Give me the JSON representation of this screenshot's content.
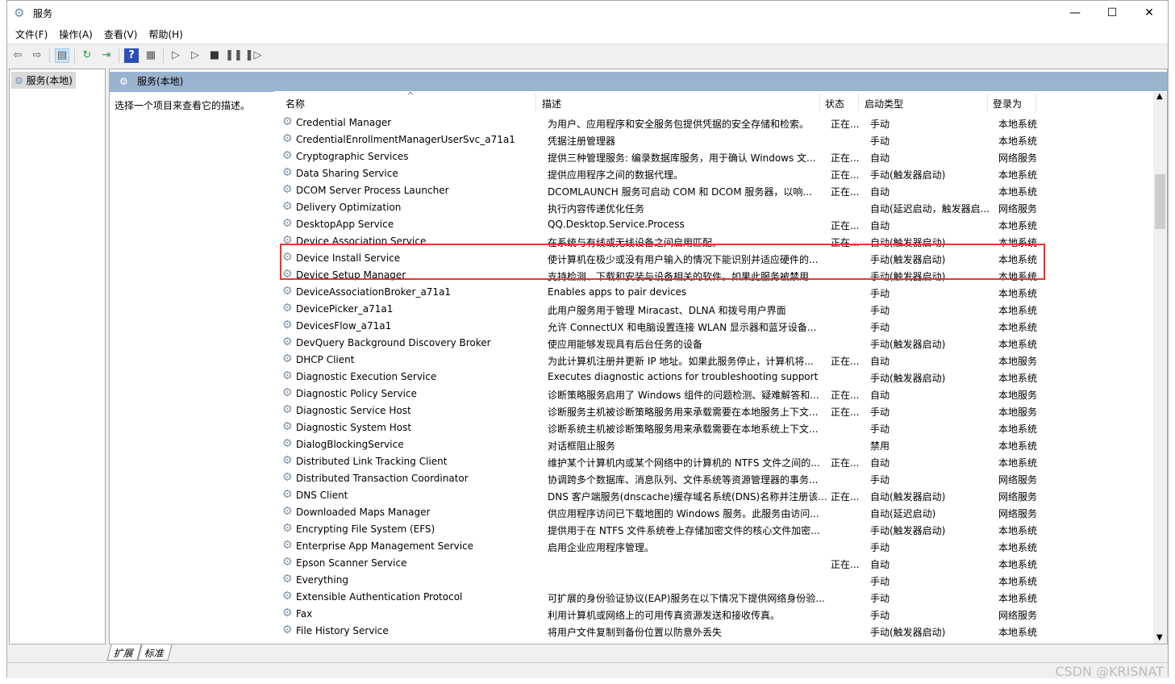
{
  "window": {
    "title": "服务",
    "minimize": "—",
    "maximize": "☐",
    "close": "✕"
  },
  "menu": [
    "文件(F)",
    "操作(A)",
    "查看(V)",
    "帮助(H)"
  ],
  "toolbar": [
    "back-icon",
    "forward-icon",
    "show-hide-tree-icon",
    "refresh-icon",
    "export-icon",
    "help-icon",
    "properties-icon",
    "start-icon",
    "start-alt-icon",
    "stop-icon",
    "pause-icon",
    "resume-icon"
  ],
  "tree": {
    "selected": "服务(本地)"
  },
  "panel": {
    "title": "服务(本地)",
    "description_hint": "选择一个项目来查看它的描述。"
  },
  "columns": {
    "name": "名称",
    "description": "描述",
    "status": "状态",
    "startup": "启动类型",
    "logon": "登录为"
  },
  "rows": [
    [
      "Credential Manager",
      "为用户、应用程序和安全服务包提供凭据的安全存储和检索。",
      "正在...",
      "手动",
      "本地系统"
    ],
    [
      "CredentialEnrollmentManagerUserSvc_a71a1",
      "凭据注册管理器",
      "",
      "手动",
      "本地系统"
    ],
    [
      "Cryptographic Services",
      "提供三种管理服务: 编录数据库服务，用于确认 Windows 文...",
      "正在...",
      "自动",
      "网络服务"
    ],
    [
      "Data Sharing Service",
      "提供应用程序之间的数据代理。",
      "正在...",
      "手动(触发器启动)",
      "本地系统"
    ],
    [
      "DCOM Server Process Launcher",
      "DCOMLAUNCH 服务可启动 COM 和 DCOM 服务器，以响...",
      "正在...",
      "自动",
      "本地系统"
    ],
    [
      "Delivery Optimization",
      "执行内容传递优化任务",
      "",
      "自动(延迟启动，触发器启...",
      "网络服务"
    ],
    [
      "DesktopApp Service",
      "QQ.Desktop.Service.Process",
      "正在...",
      "自动",
      "本地系统"
    ],
    [
      "Device Association Service",
      "在系统与有线或无线设备之间启用匹配。",
      "正在...",
      "自动(触发器启动)",
      "本地系统"
    ],
    [
      "Device Install Service",
      "使计算机在极少或没有用户输入的情况下能识别并适应硬件的...",
      "",
      "手动(触发器启动)",
      "本地系统"
    ],
    [
      "Device Setup Manager",
      "支持检测、下载和安装与设备相关的软件。如果此服务被禁用...",
      "",
      "手动(触发器启动)",
      "本地系统"
    ],
    [
      "DeviceAssociationBroker_a71a1",
      "Enables apps to pair devices",
      "",
      "手动",
      "本地系统"
    ],
    [
      "DevicePicker_a71a1",
      "此用户服务用于管理 Miracast、DLNA 和拨号用户界面",
      "",
      "手动",
      "本地系统"
    ],
    [
      "DevicesFlow_a71a1",
      "允许 ConnectUX 和电脑设置连接 WLAN 显示器和蓝牙设备...",
      "",
      "手动",
      "本地系统"
    ],
    [
      "DevQuery Background Discovery Broker",
      "使应用能够发现具有后台任务的设备",
      "",
      "手动(触发器启动)",
      "本地系统"
    ],
    [
      "DHCP Client",
      "为此计算机注册并更新 IP 地址。如果此服务停止，计算机将...",
      "正在...",
      "自动",
      "本地服务"
    ],
    [
      "Diagnostic Execution Service",
      "Executes diagnostic actions for troubleshooting support",
      "",
      "手动(触发器启动)",
      "本地系统"
    ],
    [
      "Diagnostic Policy Service",
      "诊断策略服务启用了 Windows 组件的问题检测、疑难解答和...",
      "正在...",
      "自动",
      "本地服务"
    ],
    [
      "Diagnostic Service Host",
      "诊断服务主机被诊断策略服务用来承载需要在本地服务上下文...",
      "正在...",
      "手动",
      "本地服务"
    ],
    [
      "Diagnostic System Host",
      "诊断系统主机被诊断策略服务用来承载需要在本地系统上下文...",
      "",
      "手动",
      "本地系统"
    ],
    [
      "DialogBlockingService",
      "对话框阻止服务",
      "",
      "禁用",
      "本地系统"
    ],
    [
      "Distributed Link Tracking Client",
      "维护某个计算机内或某个网络中的计算机的 NTFS 文件之间的...",
      "正在...",
      "自动",
      "本地系统"
    ],
    [
      "Distributed Transaction Coordinator",
      "协调跨多个数据库、消息队列、文件系统等资源管理器的事务...",
      "",
      "手动",
      "网络服务"
    ],
    [
      "DNS Client",
      "DNS 客户端服务(dnscache)缓存域名系统(DNS)名称并注册该...",
      "正在...",
      "自动(触发器启动)",
      "网络服务"
    ],
    [
      "Downloaded Maps Manager",
      "供应用程序访问已下载地图的 Windows 服务。此服务由访问...",
      "",
      "自动(延迟启动)",
      "网络服务"
    ],
    [
      "Encrypting File System (EFS)",
      "提供用于在 NTFS 文件系统卷上存储加密文件的核心文件加密...",
      "",
      "手动(触发器启动)",
      "本地系统"
    ],
    [
      "Enterprise App Management Service",
      "启用企业应用程序管理。",
      "",
      "手动",
      "本地系统"
    ],
    [
      "Epson Scanner Service",
      "",
      "正在...",
      "自动",
      "本地系统"
    ],
    [
      "Everything",
      "",
      "",
      "手动",
      "本地系统"
    ],
    [
      "Extensible Authentication Protocol",
      "可扩展的身份验证协议(EAP)服务在以下情况下提供网络身份验...",
      "",
      "手动",
      "本地系统"
    ],
    [
      "Fax",
      "利用计算机或网络上的可用传真资源发送和接收传真。",
      "",
      "手动",
      "网络服务"
    ],
    [
      "File History Service",
      "将用户文件复制到备份位置以防意外丢失",
      "",
      "手动(触发器启动)",
      "本地系统"
    ]
  ],
  "tabs": [
    "扩展",
    "标准"
  ],
  "watermark": "CSDN @KRISNAT",
  "highlight_color": "#e53935"
}
